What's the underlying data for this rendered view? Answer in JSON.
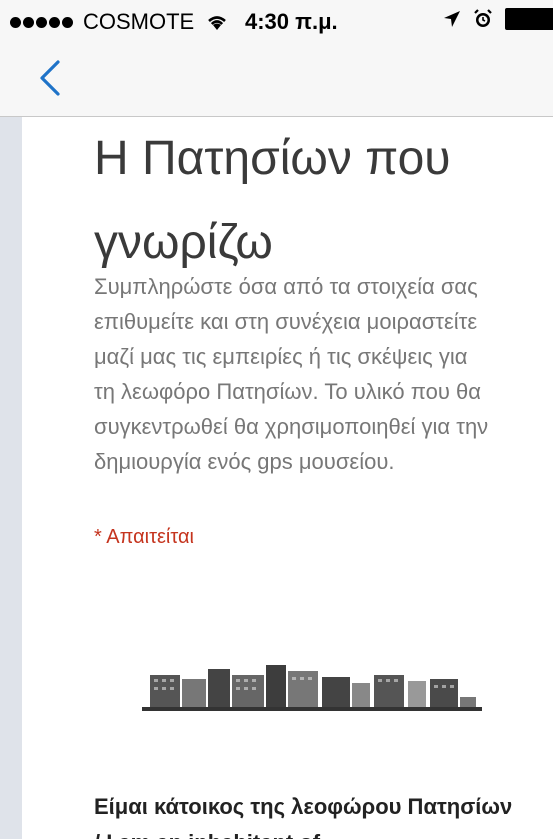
{
  "status_bar": {
    "carrier": "COSMOTE",
    "time": "4:30 π.μ.",
    "icons": [
      "signal-dots-icon",
      "wifi-icon",
      "location-arrow-icon",
      "alarm-clock-icon",
      "battery-icon"
    ]
  },
  "nav": {
    "back_icon": "chevron-left-icon",
    "accent_color": "#1f73c8"
  },
  "form": {
    "title": "Η Πατησίων που γνωρίζω",
    "description": "Συμπληρώστε όσα από τα στοιχεία σας επιθυμείτε και στη συνέχεια μοιραστείτε μαζί μας τις εμπειρίες ή τις σκέψεις για τη λεωφόρο Πατησίων. Το υλικό που θα συγκεντρωθεί θα χρησιμοποιηθεί για την δημιουργία ενός gps μουσείου.",
    "required_label": "* Απαιτείται",
    "required_color": "#c5341e",
    "first_question": "Είμαι κάτοικος της λεοφώρου Πατησίων / I am an inhabitant of"
  }
}
